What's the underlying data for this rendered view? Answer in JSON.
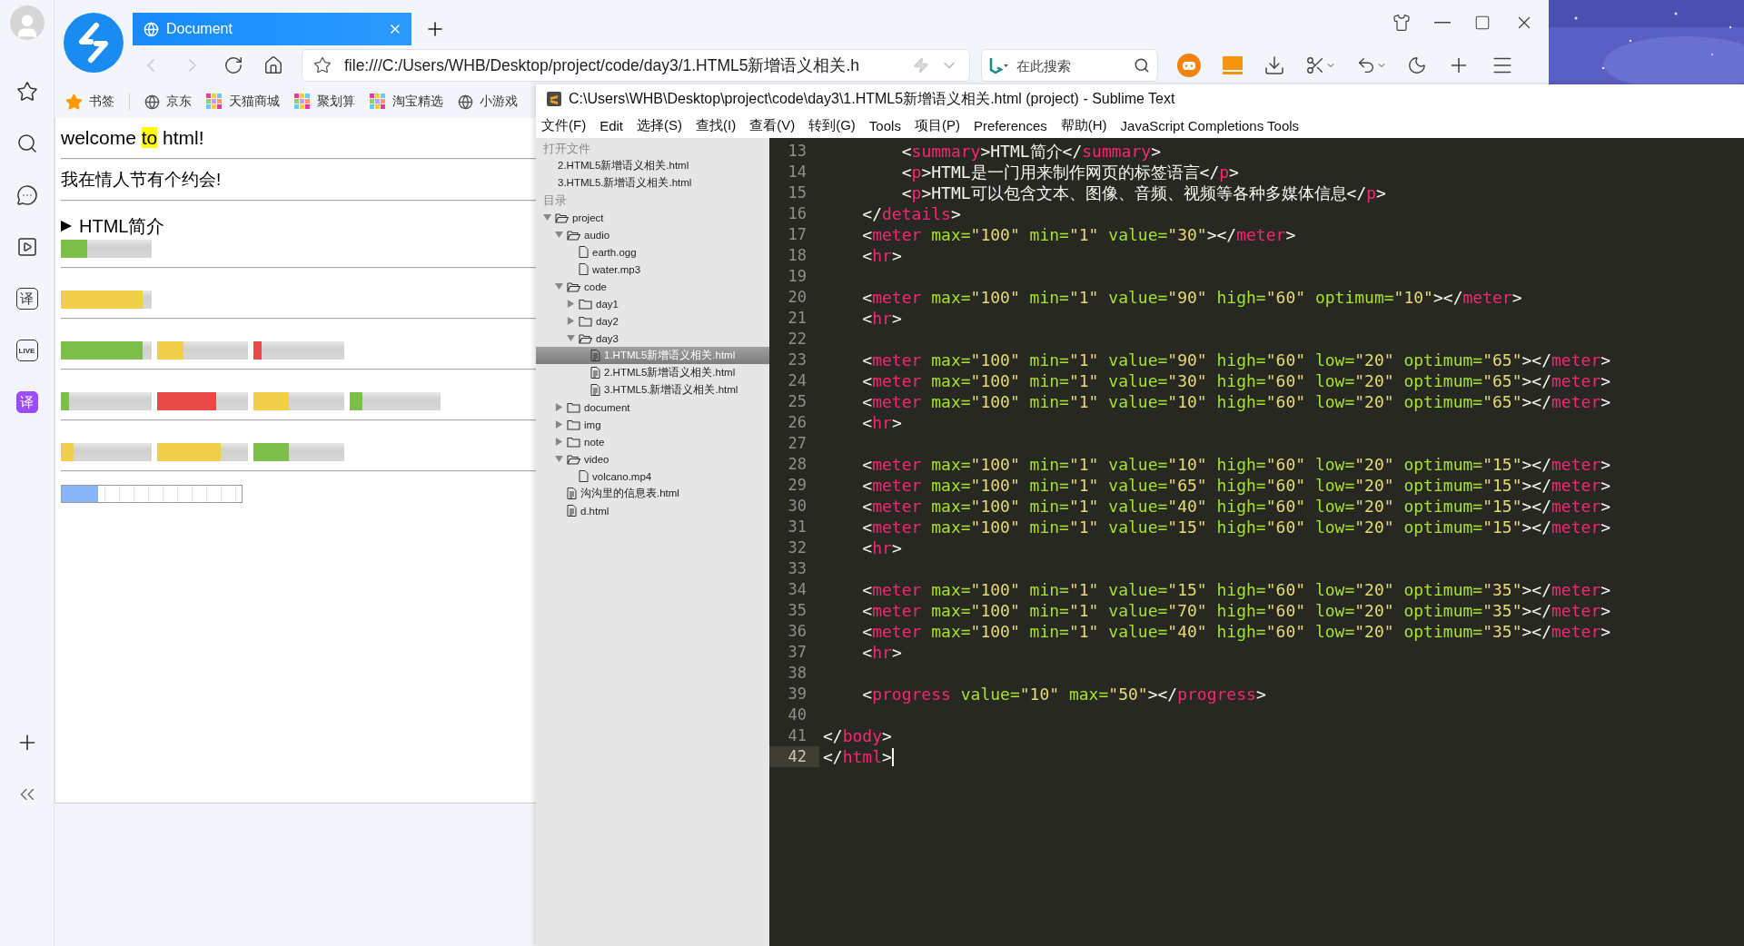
{
  "browser": {
    "tab": {
      "title": "Document",
      "selected": true
    },
    "address": {
      "value": "file:///C:/Users/WHB/Desktop/project/code/day3/1.HTML5新增语义相关.h"
    },
    "search": {
      "placeholder": "在此搜索"
    },
    "bookmarks": [
      {
        "label": "书签",
        "kind": "star"
      },
      {
        "label": "京东",
        "kind": "globe"
      },
      {
        "label": "天猫商城",
        "kind": "tile"
      },
      {
        "label": "聚划算",
        "kind": "tile"
      },
      {
        "label": "淘宝精选",
        "kind": "tile"
      },
      {
        "label": "小游戏",
        "kind": "globe"
      }
    ],
    "rail": [
      {
        "kind": "star"
      },
      {
        "kind": "search"
      },
      {
        "kind": "chat"
      },
      {
        "kind": "video"
      },
      {
        "kind": "badge",
        "glyph": "译"
      },
      {
        "kind": "badge",
        "glyph": "LIVE"
      },
      {
        "kind": "badge-filled",
        "glyph": "译"
      }
    ],
    "page": {
      "heading": [
        {
          "text": "welcome ",
          "marked": false
        },
        {
          "text": "to",
          "marked": true
        },
        {
          "text": " html!",
          "marked": false
        }
      ],
      "date_text": "我在情人节有个约会!",
      "details": {
        "summary": "HTML简介",
        "expanded": false
      },
      "meter_groups": [
        [
          {
            "level": 0.29,
            "color": "#7cc04b"
          }
        ],
        [
          {
            "level": 0.9,
            "color": "#f0d04a"
          }
        ],
        [
          {
            "level": 0.9,
            "color": "#7cc04b"
          },
          {
            "level": 0.29,
            "color": "#f0d04a"
          },
          {
            "level": 0.09,
            "color": "#e84a4a"
          }
        ],
        [
          {
            "level": 0.09,
            "color": "#7cc04b"
          },
          {
            "level": 0.65,
            "color": "#e84a4a"
          },
          {
            "level": 0.39,
            "color": "#f0d04a"
          },
          {
            "level": 0.14,
            "color": "#7cc04b"
          }
        ],
        [
          {
            "level": 0.14,
            "color": "#f0d04a"
          },
          {
            "level": 0.7,
            "color": "#f0d04a"
          },
          {
            "level": 0.39,
            "color": "#7cc04b"
          }
        ]
      ],
      "progress": {
        "level": 0.2
      }
    }
  },
  "sublime": {
    "title": "C:\\Users\\WHB\\Desktop\\project\\code\\day3\\1.HTML5新增语义相关.html (project) - Sublime Text",
    "menu": [
      "文件(F)",
      "Edit",
      "选择(S)",
      "查找(I)",
      "查看(V)",
      "转到(G)",
      "Tools",
      "项目(P)",
      "Preferences",
      "帮助(H)",
      "JavaScript Completions Tools"
    ],
    "open_files_header": "打开文件",
    "open_files": [
      "2.HTML5新增语义相关.html",
      "3.HTML5.新增语义相关.html"
    ],
    "folders_header": "目录",
    "tree": [
      {
        "name": "project",
        "kind": "folder",
        "expanded": true,
        "selected": false,
        "children": [
          {
            "name": "audio",
            "kind": "folder",
            "expanded": true,
            "selected": false,
            "children": [
              {
                "name": "earth.ogg",
                "kind": "file",
                "selected": false
              },
              {
                "name": "water.mp3",
                "kind": "file",
                "selected": false
              }
            ]
          },
          {
            "name": "code",
            "kind": "folder",
            "expanded": true,
            "selected": false,
            "children": [
              {
                "name": "day1",
                "kind": "folder",
                "expanded": false,
                "selected": false
              },
              {
                "name": "day2",
                "kind": "folder",
                "expanded": false,
                "selected": false
              },
              {
                "name": "day3",
                "kind": "folder",
                "expanded": true,
                "selected": false,
                "children": [
                  {
                    "name": "1.HTML5新增语义相关.html",
                    "kind": "page",
                    "selected": true
                  },
                  {
                    "name": "2.HTML5新增语义相关.html",
                    "kind": "page",
                    "selected": false
                  },
                  {
                    "name": "3.HTML5.新增语义相关.html",
                    "kind": "page",
                    "selected": false
                  }
                ]
              }
            ]
          },
          {
            "name": "document",
            "kind": "folder",
            "expanded": false,
            "selected": false
          },
          {
            "name": "img",
            "kind": "folder",
            "expanded": false,
            "selected": false
          },
          {
            "name": "note",
            "kind": "folder",
            "expanded": false,
            "selected": false
          },
          {
            "name": "video",
            "kind": "folder",
            "expanded": true,
            "selected": false,
            "children": [
              {
                "name": "volcano.mp4",
                "kind": "file",
                "selected": false
              }
            ]
          },
          {
            "name": "沟沟里的信息表.html",
            "kind": "page",
            "selected": false
          },
          {
            "name": "d.html",
            "kind": "page",
            "selected": false
          }
        ]
      }
    ],
    "lines": [
      {
        "number": "13",
        "current": false,
        "tokens": [
          {
            "kind": "punct",
            "text": "        <"
          },
          {
            "kind": "tag",
            "text": "summary"
          },
          {
            "kind": "punct",
            "text": ">HTML简介</"
          },
          {
            "kind": "tag",
            "text": "summary"
          },
          {
            "kind": "punct",
            "text": ">"
          }
        ]
      },
      {
        "number": "14",
        "current": false,
        "tokens": [
          {
            "kind": "punct",
            "text": "        <"
          },
          {
            "kind": "tag",
            "text": "p"
          },
          {
            "kind": "punct",
            "text": ">HTML是一门用来制作网页的标签语言</"
          },
          {
            "kind": "tag",
            "text": "p"
          },
          {
            "kind": "punct",
            "text": ">"
          }
        ]
      },
      {
        "number": "15",
        "current": false,
        "tokens": [
          {
            "kind": "punct",
            "text": "        <"
          },
          {
            "kind": "tag",
            "text": "p"
          },
          {
            "kind": "punct",
            "text": ">HTML可以包含文本、图像、音频、视频等各种多媒体信息</"
          },
          {
            "kind": "tag",
            "text": "p"
          },
          {
            "kind": "punct",
            "text": ">"
          }
        ]
      },
      {
        "number": "16",
        "current": false,
        "tokens": [
          {
            "kind": "punct",
            "text": "    </"
          },
          {
            "kind": "tag",
            "text": "details"
          },
          {
            "kind": "punct",
            "text": ">"
          }
        ]
      },
      {
        "number": "17",
        "current": false,
        "tokens": [
          {
            "kind": "punct",
            "text": "    <"
          },
          {
            "kind": "tag",
            "text": "meter"
          },
          {
            "kind": "attr",
            "text": " max="
          },
          {
            "kind": "string",
            "text": "\"100\""
          },
          {
            "kind": "attr",
            "text": " min="
          },
          {
            "kind": "string",
            "text": "\"1\""
          },
          {
            "kind": "attr",
            "text": " value="
          },
          {
            "kind": "string",
            "text": "\"30\""
          },
          {
            "kind": "punct",
            "text": "></"
          },
          {
            "kind": "tag",
            "text": "meter"
          },
          {
            "kind": "punct",
            "text": ">"
          }
        ]
      },
      {
        "number": "18",
        "current": false,
        "tokens": [
          {
            "kind": "punct",
            "text": "    <"
          },
          {
            "kind": "tag",
            "text": "hr"
          },
          {
            "kind": "punct",
            "text": ">"
          }
        ]
      },
      {
        "number": "19",
        "current": false
      },
      {
        "number": "20",
        "current": false,
        "tokens": [
          {
            "kind": "punct",
            "text": "    <"
          },
          {
            "kind": "tag",
            "text": "meter"
          },
          {
            "kind": "attr",
            "text": " max="
          },
          {
            "kind": "string",
            "text": "\"100\""
          },
          {
            "kind": "attr",
            "text": " min="
          },
          {
            "kind": "string",
            "text": "\"1\""
          },
          {
            "kind": "attr",
            "text": " value="
          },
          {
            "kind": "string",
            "text": "\"90\""
          },
          {
            "kind": "attr",
            "text": " high="
          },
          {
            "kind": "string",
            "text": "\"60\""
          },
          {
            "kind": "attr",
            "text": " optimum="
          },
          {
            "kind": "string",
            "text": "\"10\""
          },
          {
            "kind": "punct",
            "text": "></"
          },
          {
            "kind": "tag",
            "text": "meter"
          },
          {
            "kind": "punct",
            "text": ">"
          }
        ]
      },
      {
        "number": "21",
        "current": false,
        "tokens": [
          {
            "kind": "punct",
            "text": "    <"
          },
          {
            "kind": "tag",
            "text": "hr"
          },
          {
            "kind": "punct",
            "text": ">"
          }
        ]
      },
      {
        "number": "22",
        "current": false
      },
      {
        "number": "23",
        "current": false,
        "tokens": [
          {
            "kind": "punct",
            "text": "    <"
          },
          {
            "kind": "tag",
            "text": "meter"
          },
          {
            "kind": "attr",
            "text": " max="
          },
          {
            "kind": "string",
            "text": "\"100\""
          },
          {
            "kind": "attr",
            "text": " min="
          },
          {
            "kind": "string",
            "text": "\"1\""
          },
          {
            "kind": "attr",
            "text": " value="
          },
          {
            "kind": "string",
            "text": "\"90\""
          },
          {
            "kind": "attr",
            "text": " high="
          },
          {
            "kind": "string",
            "text": "\"60\""
          },
          {
            "kind": "attr",
            "text": " low="
          },
          {
            "kind": "string",
            "text": "\"20\""
          },
          {
            "kind": "attr",
            "text": " optimum="
          },
          {
            "kind": "string",
            "text": "\"65\""
          },
          {
            "kind": "punct",
            "text": "></"
          },
          {
            "kind": "tag",
            "text": "meter"
          },
          {
            "kind": "punct",
            "text": ">"
          }
        ]
      },
      {
        "number": "24",
        "current": false,
        "tokens": [
          {
            "kind": "punct",
            "text": "    <"
          },
          {
            "kind": "tag",
            "text": "meter"
          },
          {
            "kind": "attr",
            "text": " max="
          },
          {
            "kind": "string",
            "text": "\"100\""
          },
          {
            "kind": "attr",
            "text": " min="
          },
          {
            "kind": "string",
            "text": "\"1\""
          },
          {
            "kind": "attr",
            "text": " value="
          },
          {
            "kind": "string",
            "text": "\"30\""
          },
          {
            "kind": "attr",
            "text": " high="
          },
          {
            "kind": "string",
            "text": "\"60\""
          },
          {
            "kind": "attr",
            "text": " low="
          },
          {
            "kind": "string",
            "text": "\"20\""
          },
          {
            "kind": "attr",
            "text": " optimum="
          },
          {
            "kind": "string",
            "text": "\"65\""
          },
          {
            "kind": "punct",
            "text": "></"
          },
          {
            "kind": "tag",
            "text": "meter"
          },
          {
            "kind": "punct",
            "text": ">"
          }
        ]
      },
      {
        "number": "25",
        "current": false,
        "tokens": [
          {
            "kind": "punct",
            "text": "    <"
          },
          {
            "kind": "tag",
            "text": "meter"
          },
          {
            "kind": "attr",
            "text": " max="
          },
          {
            "kind": "string",
            "text": "\"100\""
          },
          {
            "kind": "attr",
            "text": " min="
          },
          {
            "kind": "string",
            "text": "\"1\""
          },
          {
            "kind": "attr",
            "text": " value="
          },
          {
            "kind": "string",
            "text": "\"10\""
          },
          {
            "kind": "attr",
            "text": " high="
          },
          {
            "kind": "string",
            "text": "\"60\""
          },
          {
            "kind": "attr",
            "text": " low="
          },
          {
            "kind": "string",
            "text": "\"20\""
          },
          {
            "kind": "attr",
            "text": " optimum="
          },
          {
            "kind": "string",
            "text": "\"65\""
          },
          {
            "kind": "punct",
            "text": "></"
          },
          {
            "kind": "tag",
            "text": "meter"
          },
          {
            "kind": "punct",
            "text": ">"
          }
        ]
      },
      {
        "number": "26",
        "current": false,
        "tokens": [
          {
            "kind": "punct",
            "text": "    <"
          },
          {
            "kind": "tag",
            "text": "hr"
          },
          {
            "kind": "punct",
            "text": ">"
          }
        ]
      },
      {
        "number": "27",
        "current": false
      },
      {
        "number": "28",
        "current": false,
        "tokens": [
          {
            "kind": "punct",
            "text": "    <"
          },
          {
            "kind": "tag",
            "text": "meter"
          },
          {
            "kind": "attr",
            "text": " max="
          },
          {
            "kind": "string",
            "text": "\"100\""
          },
          {
            "kind": "attr",
            "text": " min="
          },
          {
            "kind": "string",
            "text": "\"1\""
          },
          {
            "kind": "attr",
            "text": " value="
          },
          {
            "kind": "string",
            "text": "\"10\""
          },
          {
            "kind": "attr",
            "text": " high="
          },
          {
            "kind": "string",
            "text": "\"60\""
          },
          {
            "kind": "attr",
            "text": " low="
          },
          {
            "kind": "string",
            "text": "\"20\""
          },
          {
            "kind": "attr",
            "text": " optimum="
          },
          {
            "kind": "string",
            "text": "\"15\""
          },
          {
            "kind": "punct",
            "text": "></"
          },
          {
            "kind": "tag",
            "text": "meter"
          },
          {
            "kind": "punct",
            "text": ">"
          }
        ]
      },
      {
        "number": "29",
        "current": false,
        "tokens": [
          {
            "kind": "punct",
            "text": "    <"
          },
          {
            "kind": "tag",
            "text": "meter"
          },
          {
            "kind": "attr",
            "text": " max="
          },
          {
            "kind": "string",
            "text": "\"100\""
          },
          {
            "kind": "attr",
            "text": " min="
          },
          {
            "kind": "string",
            "text": "\"1\""
          },
          {
            "kind": "attr",
            "text": " value="
          },
          {
            "kind": "string",
            "text": "\"65\""
          },
          {
            "kind": "attr",
            "text": " high="
          },
          {
            "kind": "string",
            "text": "\"60\""
          },
          {
            "kind": "attr",
            "text": " low="
          },
          {
            "kind": "string",
            "text": "\"20\""
          },
          {
            "kind": "attr",
            "text": " optimum="
          },
          {
            "kind": "string",
            "text": "\"15\""
          },
          {
            "kind": "punct",
            "text": "></"
          },
          {
            "kind": "tag",
            "text": "meter"
          },
          {
            "kind": "punct",
            "text": ">"
          }
        ]
      },
      {
        "number": "30",
        "current": false,
        "tokens": [
          {
            "kind": "punct",
            "text": "    <"
          },
          {
            "kind": "tag",
            "text": "meter"
          },
          {
            "kind": "attr",
            "text": " max="
          },
          {
            "kind": "string",
            "text": "\"100\""
          },
          {
            "kind": "attr",
            "text": " min="
          },
          {
            "kind": "string",
            "text": "\"1\""
          },
          {
            "kind": "attr",
            "text": " value="
          },
          {
            "kind": "string",
            "text": "\"40\""
          },
          {
            "kind": "attr",
            "text": " high="
          },
          {
            "kind": "string",
            "text": "\"60\""
          },
          {
            "kind": "attr",
            "text": " low="
          },
          {
            "kind": "string",
            "text": "\"20\""
          },
          {
            "kind": "attr",
            "text": " optimum="
          },
          {
            "kind": "string",
            "text": "\"15\""
          },
          {
            "kind": "punct",
            "text": "></"
          },
          {
            "kind": "tag",
            "text": "meter"
          },
          {
            "kind": "punct",
            "text": ">"
          }
        ]
      },
      {
        "number": "31",
        "current": false,
        "tokens": [
          {
            "kind": "punct",
            "text": "    <"
          },
          {
            "kind": "tag",
            "text": "meter"
          },
          {
            "kind": "attr",
            "text": " max="
          },
          {
            "kind": "string",
            "text": "\"100\""
          },
          {
            "kind": "attr",
            "text": " min="
          },
          {
            "kind": "string",
            "text": "\"1\""
          },
          {
            "kind": "attr",
            "text": " value="
          },
          {
            "kind": "string",
            "text": "\"15\""
          },
          {
            "kind": "attr",
            "text": " high="
          },
          {
            "kind": "string",
            "text": "\"60\""
          },
          {
            "kind": "attr",
            "text": " low="
          },
          {
            "kind": "string",
            "text": "\"20\""
          },
          {
            "kind": "attr",
            "text": " optimum="
          },
          {
            "kind": "string",
            "text": "\"15\""
          },
          {
            "kind": "punct",
            "text": "></"
          },
          {
            "kind": "tag",
            "text": "meter"
          },
          {
            "kind": "punct",
            "text": ">"
          }
        ]
      },
      {
        "number": "32",
        "current": false,
        "tokens": [
          {
            "kind": "punct",
            "text": "    <"
          },
          {
            "kind": "tag",
            "text": "hr"
          },
          {
            "kind": "punct",
            "text": ">"
          }
        ]
      },
      {
        "number": "33",
        "current": false
      },
      {
        "number": "34",
        "current": false,
        "tokens": [
          {
            "kind": "punct",
            "text": "    <"
          },
          {
            "kind": "tag",
            "text": "meter"
          },
          {
            "kind": "attr",
            "text": " max="
          },
          {
            "kind": "string",
            "text": "\"100\""
          },
          {
            "kind": "attr",
            "text": " min="
          },
          {
            "kind": "string",
            "text": "\"1\""
          },
          {
            "kind": "attr",
            "text": " value="
          },
          {
            "kind": "string",
            "text": "\"15\""
          },
          {
            "kind": "attr",
            "text": " high="
          },
          {
            "kind": "string",
            "text": "\"60\""
          },
          {
            "kind": "attr",
            "text": " low="
          },
          {
            "kind": "string",
            "text": "\"20\""
          },
          {
            "kind": "attr",
            "text": " optimum="
          },
          {
            "kind": "string",
            "text": "\"35\""
          },
          {
            "kind": "punct",
            "text": "></"
          },
          {
            "kind": "tag",
            "text": "meter"
          },
          {
            "kind": "punct",
            "text": ">"
          }
        ]
      },
      {
        "number": "35",
        "current": false,
        "tokens": [
          {
            "kind": "punct",
            "text": "    <"
          },
          {
            "kind": "tag",
            "text": "meter"
          },
          {
            "kind": "attr",
            "text": " max="
          },
          {
            "kind": "string",
            "text": "\"100\""
          },
          {
            "kind": "attr",
            "text": " min="
          },
          {
            "kind": "string",
            "text": "\"1\""
          },
          {
            "kind": "attr",
            "text": " value="
          },
          {
            "kind": "string",
            "text": "\"70\""
          },
          {
            "kind": "attr",
            "text": " high="
          },
          {
            "kind": "string",
            "text": "\"60\""
          },
          {
            "kind": "attr",
            "text": " low="
          },
          {
            "kind": "string",
            "text": "\"20\""
          },
          {
            "kind": "attr",
            "text": " optimum="
          },
          {
            "kind": "string",
            "text": "\"35\""
          },
          {
            "kind": "punct",
            "text": "></"
          },
          {
            "kind": "tag",
            "text": "meter"
          },
          {
            "kind": "punct",
            "text": ">"
          }
        ]
      },
      {
        "number": "36",
        "current": false,
        "tokens": [
          {
            "kind": "punct",
            "text": "    <"
          },
          {
            "kind": "tag",
            "text": "meter"
          },
          {
            "kind": "attr",
            "text": " max="
          },
          {
            "kind": "string",
            "text": "\"100\""
          },
          {
            "kind": "attr",
            "text": " min="
          },
          {
            "kind": "string",
            "text": "\"1\""
          },
          {
            "kind": "attr",
            "text": " value="
          },
          {
            "kind": "string",
            "text": "\"40\""
          },
          {
            "kind": "attr",
            "text": " high="
          },
          {
            "kind": "string",
            "text": "\"60\""
          },
          {
            "kind": "attr",
            "text": " low="
          },
          {
            "kind": "string",
            "text": "\"20\""
          },
          {
            "kind": "attr",
            "text": " optimum="
          },
          {
            "kind": "string",
            "text": "\"35\""
          },
          {
            "kind": "punct",
            "text": "></"
          },
          {
            "kind": "tag",
            "text": "meter"
          },
          {
            "kind": "punct",
            "text": ">"
          }
        ]
      },
      {
        "number": "37",
        "current": false,
        "tokens": [
          {
            "kind": "punct",
            "text": "    <"
          },
          {
            "kind": "tag",
            "text": "hr"
          },
          {
            "kind": "punct",
            "text": ">"
          }
        ]
      },
      {
        "number": "38",
        "current": false
      },
      {
        "number": "39",
        "current": false,
        "tokens": [
          {
            "kind": "punct",
            "text": "    <"
          },
          {
            "kind": "tag",
            "text": "progress"
          },
          {
            "kind": "attr",
            "text": " value="
          },
          {
            "kind": "string",
            "text": "\"10\""
          },
          {
            "kind": "attr",
            "text": " max="
          },
          {
            "kind": "string",
            "text": "\"50\""
          },
          {
            "kind": "punct",
            "text": "></"
          },
          {
            "kind": "tag",
            "text": "progress"
          },
          {
            "kind": "punct",
            "text": ">"
          }
        ]
      },
      {
        "number": "40",
        "current": false
      },
      {
        "number": "41",
        "current": false,
        "tokens": [
          {
            "kind": "punct",
            "text": "</"
          },
          {
            "kind": "tag",
            "text": "body"
          },
          {
            "kind": "punct",
            "text": ">"
          }
        ]
      },
      {
        "number": "42",
        "current": true,
        "tokens": [
          {
            "kind": "punct",
            "text": "</"
          },
          {
            "kind": "tag",
            "text": "html"
          },
          {
            "kind": "punct",
            "text": ">"
          }
        ]
      }
    ]
  }
}
